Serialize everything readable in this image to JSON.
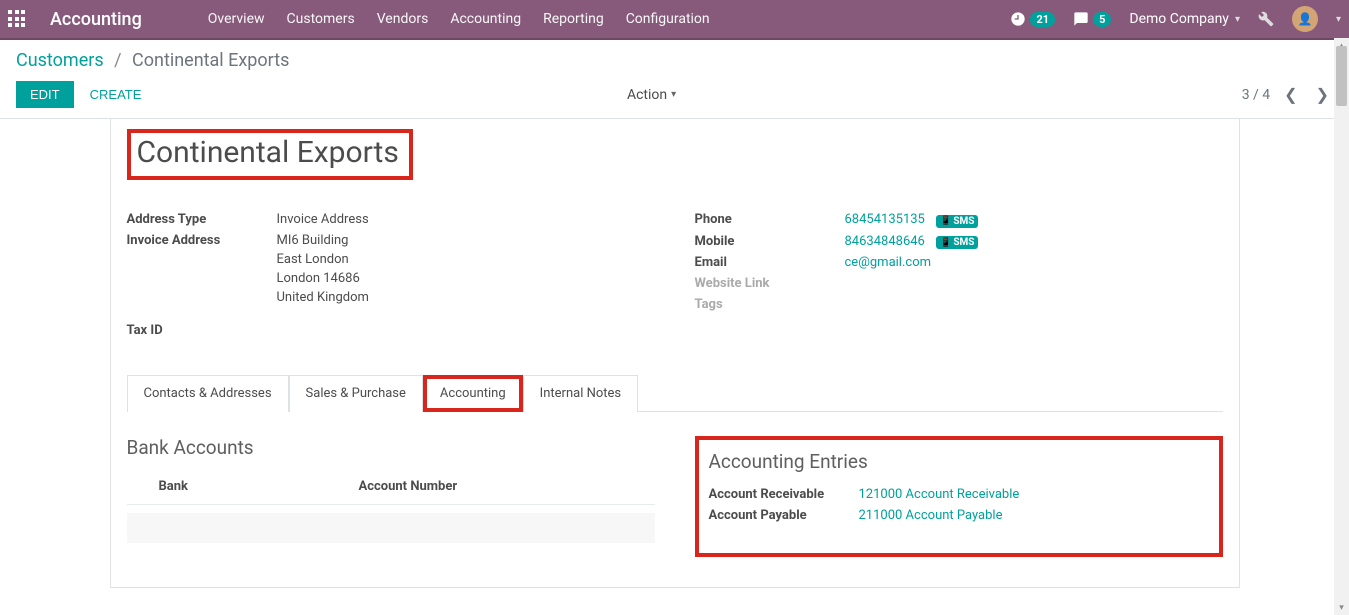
{
  "topbar": {
    "brand": "Accounting",
    "nav": [
      "Overview",
      "Customers",
      "Vendors",
      "Accounting",
      "Reporting",
      "Configuration"
    ],
    "activity_count": "21",
    "chat_count": "5",
    "company": "Demo Company"
  },
  "breadcrumb": {
    "root": "Customers",
    "current": "Continental Exports"
  },
  "actions": {
    "edit": "EDIT",
    "create": "CREATE",
    "action": "Action"
  },
  "pager": {
    "current": "3",
    "total": "4"
  },
  "record": {
    "title": "Continental Exports",
    "address_type_label": "Address Type",
    "address_type": "Invoice Address",
    "invoice_address_label": "Invoice Address",
    "addr_line1": "MI6 Building",
    "addr_line2": "East London",
    "addr_line3": "London  14686",
    "addr_line4": "United Kingdom",
    "tax_id_label": "Tax ID",
    "phone_label": "Phone",
    "phone": "68454135135",
    "mobile_label": "Mobile",
    "mobile": "84634848646",
    "email_label": "Email",
    "email": "ce@gmail.com",
    "website_label": "Website Link",
    "tags_label": "Tags",
    "sms": "SMS"
  },
  "tabs": [
    "Contacts & Addresses",
    "Sales & Purchase",
    "Accounting",
    "Internal Notes"
  ],
  "bank_section": {
    "title": "Bank Accounts",
    "col_bank": "Bank",
    "col_account": "Account Number"
  },
  "entry_section": {
    "title": "Accounting Entries",
    "receivable_label": "Account Receivable",
    "receivable_value": "121000 Account Receivable",
    "payable_label": "Account Payable",
    "payable_value": "211000 Account Payable"
  }
}
